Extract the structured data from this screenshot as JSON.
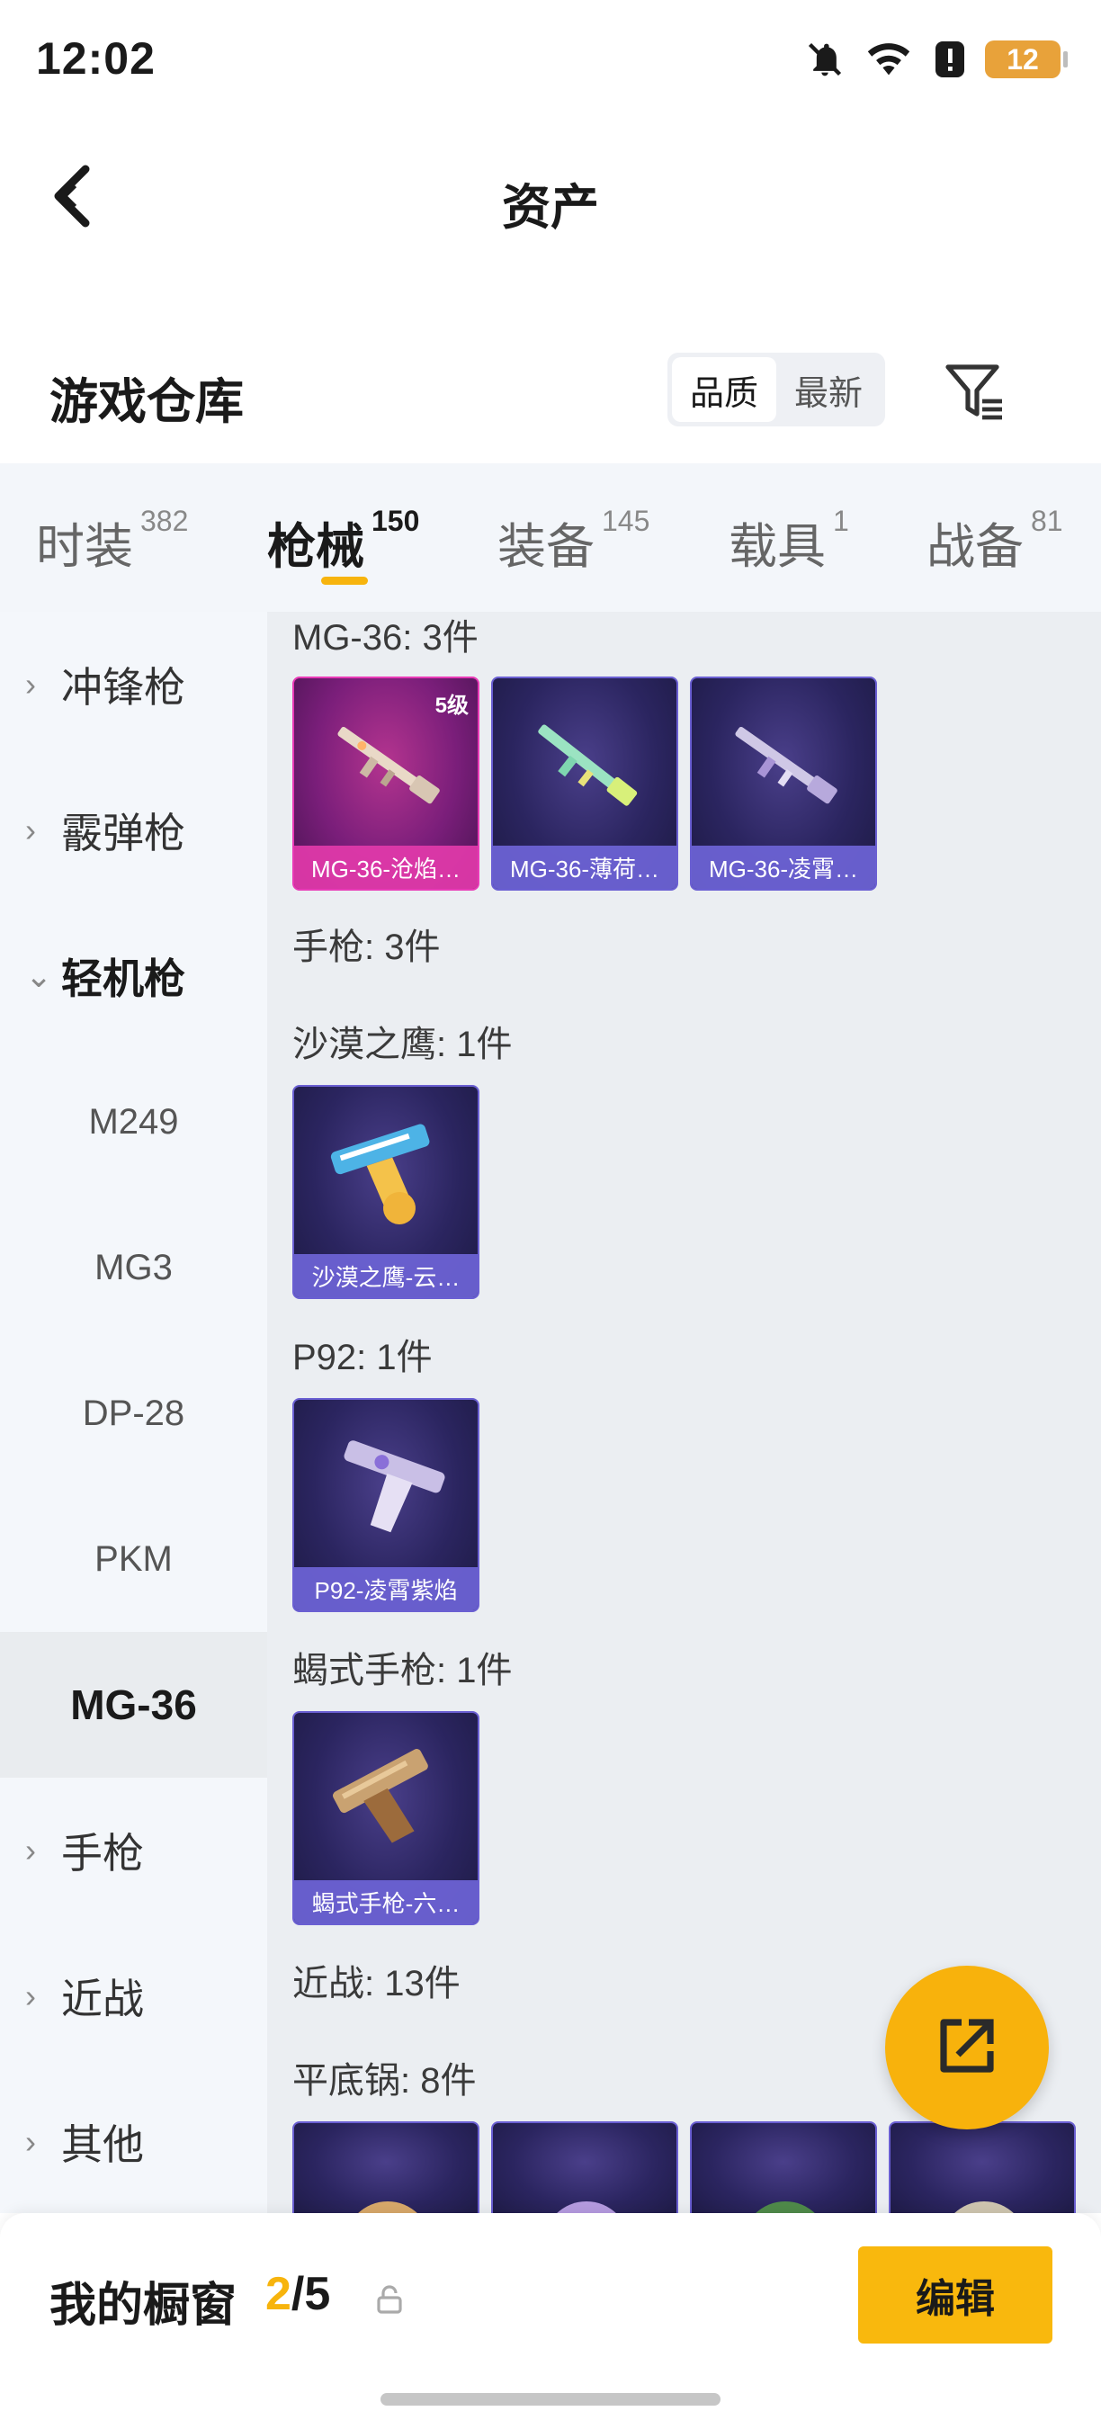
{
  "status_bar": {
    "time": "12:02",
    "battery": "12",
    "icons": [
      "bell-off-icon",
      "wifi-icon",
      "alert-icon",
      "battery-icon"
    ]
  },
  "nav": {
    "title": "资产",
    "back_icon": "back-arrow-icon"
  },
  "section": {
    "title": "游戏仓库",
    "sort_options": [
      "品质",
      "最新"
    ],
    "sort_selected": "品质",
    "filter_icon": "filter-icon"
  },
  "tabs": [
    {
      "label": "时装",
      "count": "382"
    },
    {
      "label": "枪械",
      "count": "150"
    },
    {
      "label": "装备",
      "count": "145"
    },
    {
      "label": "载具",
      "count": "1"
    },
    {
      "label": "战备",
      "count": "81"
    }
  ],
  "tab_selected": "枪械",
  "sidebar": {
    "items": [
      {
        "label": "冲锋枪",
        "type": "collapsed"
      },
      {
        "label": "霰弹枪",
        "type": "collapsed"
      },
      {
        "label": "轻机枪",
        "type": "expanded"
      },
      {
        "label": "M249",
        "type": "sub"
      },
      {
        "label": "MG3",
        "type": "sub"
      },
      {
        "label": "DP-28",
        "type": "sub"
      },
      {
        "label": "PKM",
        "type": "sub"
      },
      {
        "label": "MG-36",
        "type": "selected"
      },
      {
        "label": "手枪",
        "type": "collapsed"
      },
      {
        "label": "近战",
        "type": "collapsed"
      },
      {
        "label": "其他",
        "type": "collapsed"
      }
    ]
  },
  "content": {
    "groups": [
      {
        "title": "MG-36: 3件"
      },
      {
        "title": "手枪: 3件"
      },
      {
        "title": "沙漠之鹰: 1件"
      },
      {
        "title": "P92: 1件"
      },
      {
        "title": "蝎式手枪: 1件"
      },
      {
        "title": "近战: 13件"
      },
      {
        "title": "平底锅: 8件"
      }
    ],
    "cards": [
      {
        "name": "MG-36-沧焰…",
        "level": "5级",
        "quality": "pink",
        "art": "rifle-icon"
      },
      {
        "name": "MG-36-薄荷…",
        "quality": "purple",
        "art": "rifle-icon"
      },
      {
        "name": "MG-36-凌霄…",
        "quality": "purple",
        "art": "rifle-icon"
      },
      {
        "name": "沙漠之鹰-云…",
        "quality": "purple",
        "art": "pistol-icon"
      },
      {
        "name": "P92-凌霄紫焰",
        "quality": "purple",
        "art": "pistol-icon"
      },
      {
        "name": "蝎式手枪-六…",
        "quality": "purple",
        "art": "pistol-icon"
      }
    ]
  },
  "fab": {
    "icon": "share-external-icon"
  },
  "bottom": {
    "label": "我的橱窗",
    "current": "2",
    "total": "/5",
    "lock_icon": "lock-icon",
    "edit_label": "编辑"
  },
  "colors": {
    "accent": "#f7b40d",
    "purple_card": "#6a5fd2",
    "pink_card": "#e83ab6",
    "tab_bg": "#f3f6fa",
    "content_bg": "#ebeef2"
  }
}
